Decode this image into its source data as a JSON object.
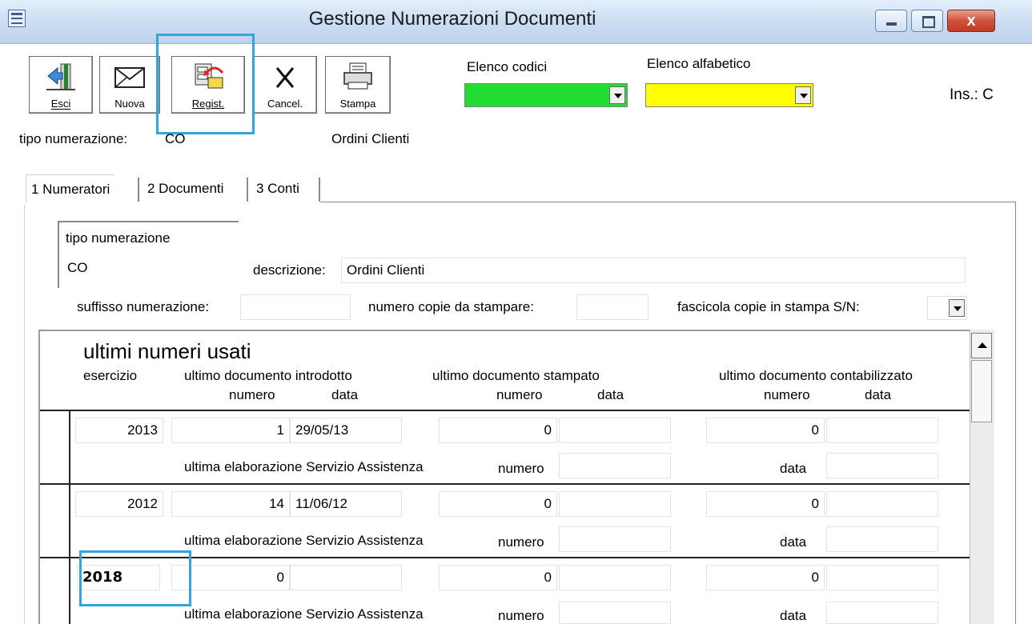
{
  "window": {
    "title": "Gestione Numerazioni Documenti",
    "close_glyph": "x"
  },
  "toolbar": {
    "exit_label": "Esci",
    "new_label": "Nuova",
    "save_label": "Regist.",
    "delete_label": "Cancel.",
    "print_label": "Stampa"
  },
  "code_list": {
    "label": "Elenco codici",
    "value": "",
    "color": "#22dd33"
  },
  "alpha_list": {
    "label": "Elenco alfabetico",
    "value": "",
    "color": "#ffff00"
  },
  "ins_status": "Ins.: C",
  "header_info": {
    "label": "tipo numerazione:",
    "code": "CO",
    "description": "Ordini Clienti"
  },
  "tabs": [
    {
      "label": "1 Numeratori"
    },
    {
      "label": "2 Documenti"
    },
    {
      "label": "3 Conti"
    }
  ],
  "form": {
    "tipo_label": "tipo numerazione",
    "tipo_value": "CO",
    "descrizione_label": "descrizione:",
    "descrizione_value": "Ordini Clienti",
    "suffisso_label": "suffisso numerazione:",
    "suffisso_value": "",
    "copie_label": "numero copie da stampare:",
    "copie_value": "",
    "fascicola_label": "fascicola copie in stampa S/N:",
    "fascicola_value": ""
  },
  "grid": {
    "title": "ultimi numeri usati",
    "col_esercizio": "esercizio",
    "col_introdotto": "ultimo documento introdotto",
    "col_stampato": "ultimo documento stampato",
    "col_contabilizzato": "ultimo documento contabilizzato",
    "sub_numero": "numero",
    "sub_data": "data",
    "assist_label": "ultima elaborazione Servizio Assistenza",
    "assist_numero": "numero",
    "assist_data": "data",
    "rows": [
      {
        "esercizio": "2013",
        "intro_num": "1",
        "intro_data": "29/05/13",
        "stamp_num": "0",
        "stamp_data": "",
        "cont_num": "0",
        "cont_data": ""
      },
      {
        "esercizio": "2012",
        "intro_num": "14",
        "intro_data": "11/06/12",
        "stamp_num": "0",
        "stamp_data": "",
        "cont_num": "0",
        "cont_data": ""
      },
      {
        "esercizio": "2018",
        "intro_num": "0",
        "intro_data": "",
        "stamp_num": "0",
        "stamp_data": "",
        "cont_num": "0",
        "cont_data": ""
      }
    ]
  },
  "highlight_color": "#34a4dc"
}
